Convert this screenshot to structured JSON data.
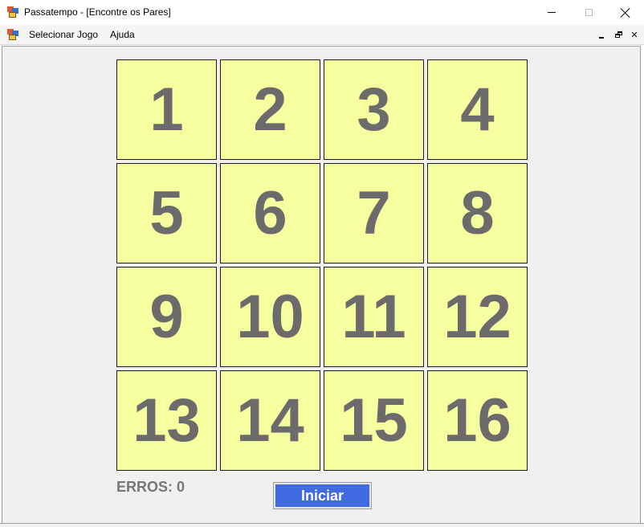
{
  "window": {
    "title": "Passatempo - [Encontre os Pares]",
    "app_icon": "app-form-icon"
  },
  "menu": {
    "items": [
      {
        "label": "Selecionar Jogo"
      },
      {
        "label": "Ajuda"
      }
    ]
  },
  "board": {
    "tiles": [
      "1",
      "2",
      "3",
      "4",
      "5",
      "6",
      "7",
      "8",
      "9",
      "10",
      "11",
      "12",
      "13",
      "14",
      "15",
      "16"
    ],
    "tile_color": "#f5ffa0",
    "number_color": "#6b6b6b"
  },
  "status": {
    "errors_label": "ERROS: 0"
  },
  "actions": {
    "start_label": "Iniciar",
    "start_color": "#4169e1"
  }
}
